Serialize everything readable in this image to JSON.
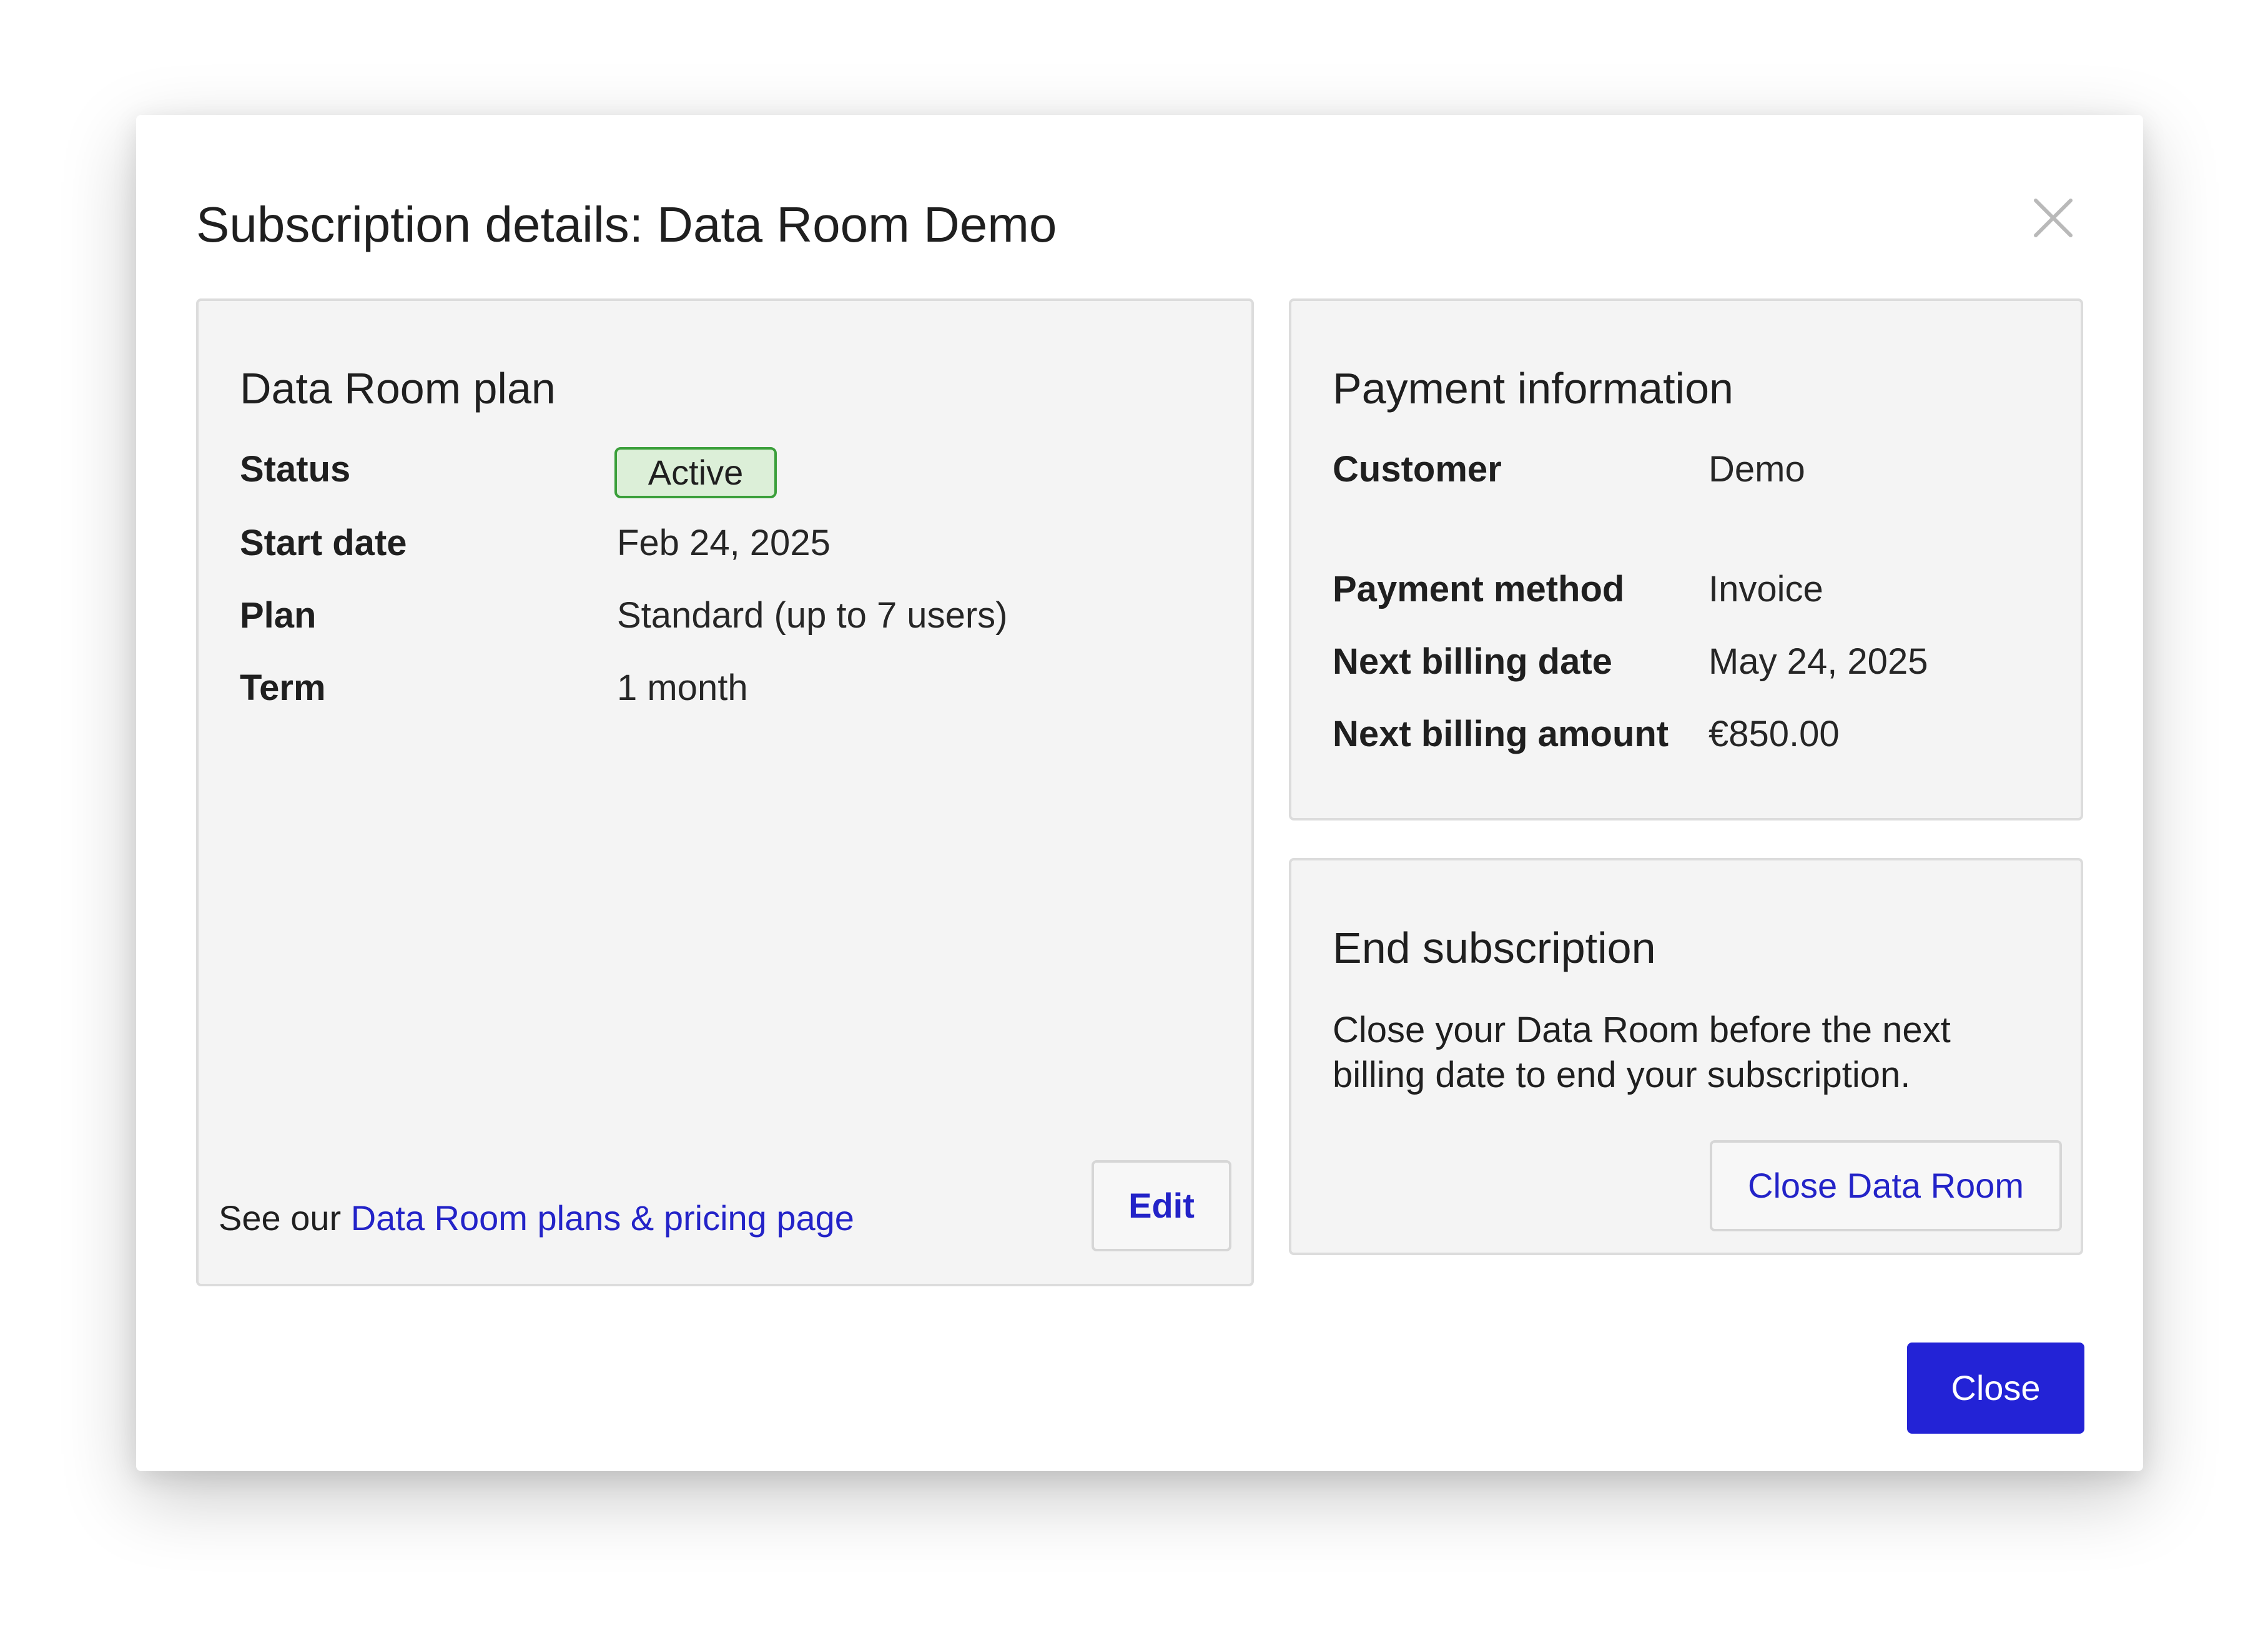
{
  "dialog": {
    "title": "Subscription details:  Data Room Demo"
  },
  "plan": {
    "title": "Data Room plan",
    "rows": [
      {
        "label": "Status",
        "value": "Active"
      },
      {
        "label": "Start date",
        "value": "Feb 24, 2025"
      },
      {
        "label": "Plan",
        "value": "Standard (up to 7 users)"
      },
      {
        "label": "Term",
        "value": "1 month"
      }
    ],
    "footer_prefix": "See our ",
    "footer_link": "Data Room plans & pricing page",
    "edit_label": "Edit",
    "status_colors": {
      "badge_bg": "#dcefd8",
      "badge_border": "#3a9f3a"
    }
  },
  "payment": {
    "title": "Payment information",
    "rows": [
      {
        "label": "Customer",
        "value": "Demo"
      },
      {
        "label": "Payment method",
        "value": "Invoice"
      },
      {
        "label": "Next billing date",
        "value": "May 24, 2025"
      },
      {
        "label": "Next billing amount",
        "value": "€850.00"
      }
    ]
  },
  "end_subscription": {
    "title": "End subscription",
    "description": "Close your Data Room before the next billing date to end your subscription.",
    "button_label": "Close Data Room"
  },
  "footer": {
    "close_label": "Close"
  },
  "colors": {
    "accent": "#2323d6",
    "link": "#2323c8",
    "card_bg": "#f4f4f4"
  },
  "icons": {
    "close": "close-icon"
  }
}
